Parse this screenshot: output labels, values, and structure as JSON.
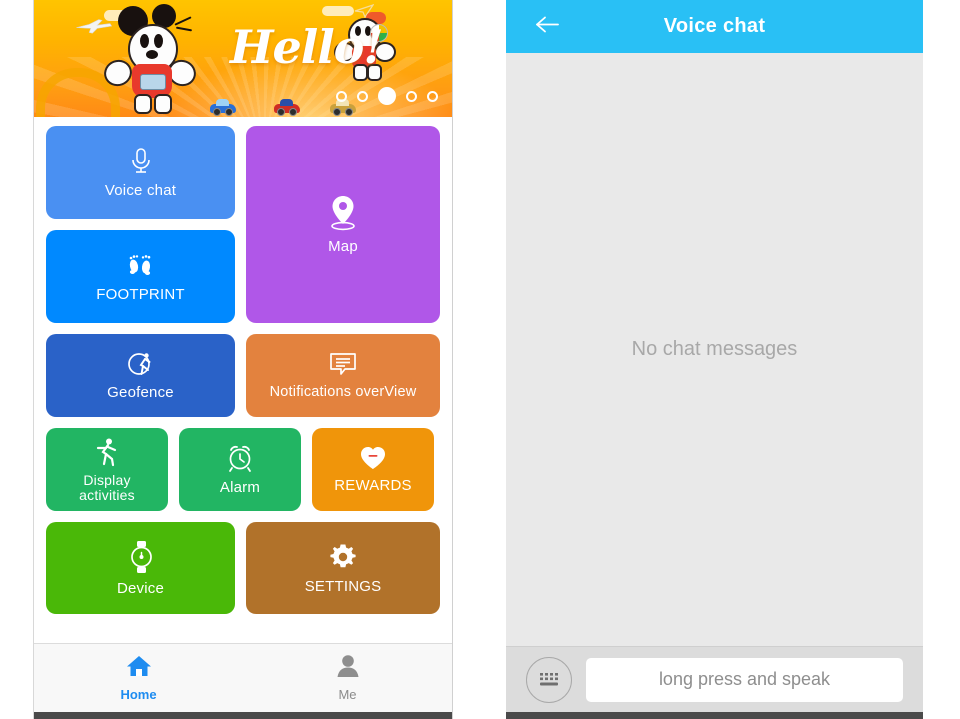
{
  "left_phone": {
    "banner": {
      "greeting": "Hello!",
      "page_dots": {
        "count": 5,
        "active_index": 2
      }
    },
    "tiles": [
      {
        "key": "voice_chat",
        "label": "Voice chat",
        "icon": "microphone-icon",
        "color": "#4a90f2"
      },
      {
        "key": "footprint",
        "label": "FOOTPRINT",
        "icon": "footprints-icon",
        "color": "#0089ff"
      },
      {
        "key": "map",
        "label": "Map",
        "icon": "map-pin-icon",
        "color": "#b057e8"
      },
      {
        "key": "geofence",
        "label": "Geofence",
        "icon": "geofence-icon",
        "color": "#2a62c8"
      },
      {
        "key": "notifications",
        "label": "Notifications overView",
        "icon": "message-lines-icon",
        "color": "#e3823e"
      },
      {
        "key": "display_activities",
        "label": "Display\nactivities",
        "icon": "running-person-icon",
        "color": "#22b563"
      },
      {
        "key": "alarm",
        "label": "Alarm",
        "icon": "alarm-clock-icon",
        "color": "#22b563"
      },
      {
        "key": "rewards",
        "label": "REWARDS",
        "icon": "heart-icon",
        "color": "#f0950a"
      },
      {
        "key": "device",
        "label": "Device",
        "icon": "smartwatch-icon",
        "color": "#4ab808"
      },
      {
        "key": "settings",
        "label": "SETTINGS",
        "icon": "gear-icon",
        "color": "#b1722a"
      }
    ],
    "tile_labels": {
      "voice_chat": "Voice chat",
      "footprint": "FOOTPRINT",
      "map": "Map",
      "geofence": "Geofence",
      "notifications": "Notifications overView",
      "display_activities_line1": "Display",
      "display_activities_line2": "activities",
      "alarm": "Alarm",
      "rewards": "REWARDS",
      "device": "Device",
      "settings": "SETTINGS"
    },
    "bottom_nav": {
      "items": [
        {
          "label": "Home",
          "icon": "home-icon",
          "active": true,
          "color": "#1e8cf0"
        },
        {
          "label": "Me",
          "icon": "person-icon",
          "active": false,
          "color": "#8b8b8b"
        }
      ],
      "home_label": "Home",
      "me_label": "Me"
    }
  },
  "right_phone": {
    "header": {
      "title": "Voice chat",
      "back_icon": "back-arrow-icon",
      "color": "#29c0f5"
    },
    "body": {
      "empty_message": "No chat messages"
    },
    "footer": {
      "keyboard_icon": "keyboard-icon",
      "speak_button_label": "long press and speak"
    }
  }
}
